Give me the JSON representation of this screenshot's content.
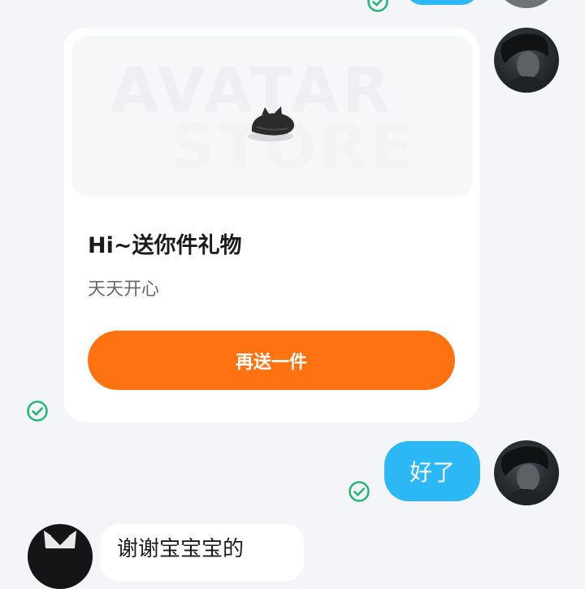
{
  "chat": {
    "gift_card": {
      "image_watermark_line1": "AVATAR",
      "image_watermark_line2": "STORE",
      "title": "Hi~送你件礼物",
      "subtitle": "天天开心",
      "resend_button_label": "再送一件"
    },
    "sent_message": {
      "text": "好了"
    },
    "received_message_partial": {
      "text": "谢谢宝宝宝的"
    }
  },
  "colors": {
    "background": "#f3f5f9",
    "sent_bubble": "#2cb7f5",
    "button": "#ff7211",
    "read_check": "#2bb673"
  },
  "icons": {
    "read_receipt": "check-circle-icon",
    "gift_item": "beret-hat-icon"
  }
}
